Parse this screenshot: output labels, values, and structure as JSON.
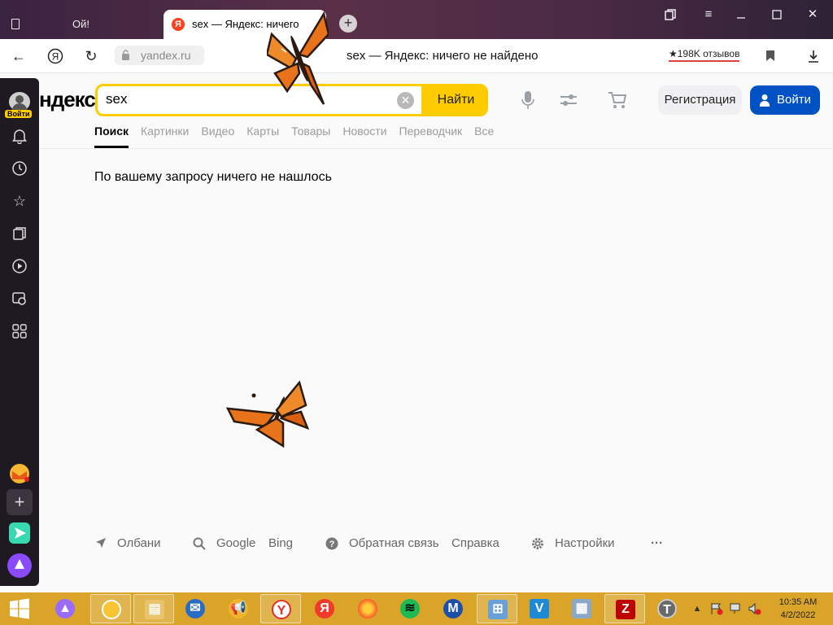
{
  "tabs": [
    {
      "label": "Ой!"
    },
    {
      "label": "sex — Яндекс: ничего"
    }
  ],
  "toolbar": {
    "url": "yandex.ru",
    "page_title": "sex — Яндекс: ничего не найдено",
    "reviews": "★198K отзывов"
  },
  "sidebar": {
    "login_badge": "Войти",
    "icons": [
      "bell-icon",
      "history-icon",
      "bookmarks-icon",
      "collections-icon",
      "video-icon",
      "screenshot-icon",
      "apps-icon"
    ]
  },
  "search": {
    "logo": "ндекс",
    "query": "sex",
    "find_label": "Найти",
    "register_label": "Регистрация",
    "login_label": "Войти"
  },
  "nav": {
    "tabs": [
      "Поиск",
      "Картинки",
      "Видео",
      "Карты",
      "Товары",
      "Новости",
      "Переводчик",
      "Все"
    ],
    "active": 0
  },
  "results": {
    "message": "По вашему запросу ничего не нашлось"
  },
  "footer": {
    "location": "Олбани",
    "google": "Google",
    "bing": "Bing",
    "feedback": "Обратная связь",
    "help": "Справка",
    "settings": "Настройки",
    "more": "···"
  },
  "taskbar": {
    "time": "10:35 AM",
    "date": "4/2/2022"
  },
  "colors": {
    "accent_yellow": "#ffcc00",
    "login_blue": "#0051c4",
    "taskbar": "#d9a428",
    "butterfly": "#e8731a"
  }
}
